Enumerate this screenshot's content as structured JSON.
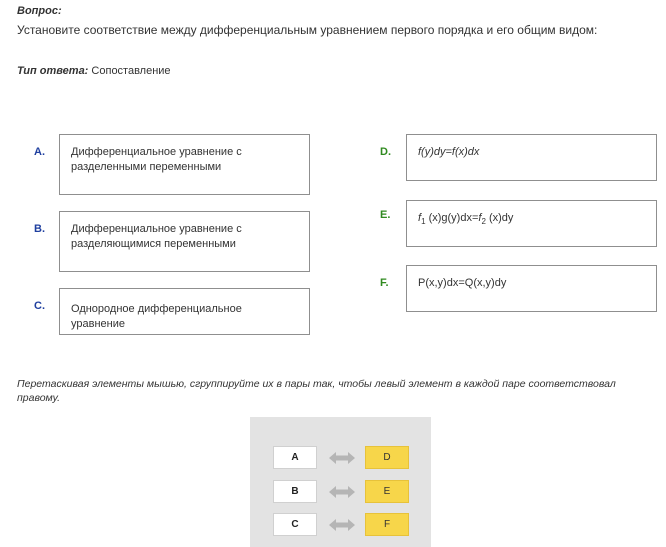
{
  "question": {
    "label": "Вопрос:",
    "text": "Установите соответствие между дифференциальным уравнением первого порядка и его общим видом:"
  },
  "answer_type": {
    "label": "Тип ответа:",
    "value": "Сопоставление"
  },
  "left_items": [
    {
      "letter": "A.",
      "text": "Дифференциальное уравнение с разделенными переменными"
    },
    {
      "letter": "B.",
      "text": "Дифференциальное уравнение с разделяющимися переменными"
    },
    {
      "letter": "C.",
      "text": "Однородное дифференциальное уравнение"
    }
  ],
  "right_items": [
    {
      "letter": "D.",
      "text": "f(y)dy=f(x)dx"
    },
    {
      "letter": "E.",
      "text": "f1 (x)g(y)dx=f2 (x)dy"
    },
    {
      "letter": "F.",
      "text": "P(x,y)dx=Q(x,y)dy"
    }
  ],
  "instruction": "Перетаскивая элементы мышью, сгруппируйте их в пары так, чтобы левый элемент в каждой паре соответствовал правому.",
  "pairs": [
    {
      "left": "A",
      "right": "D"
    },
    {
      "left": "B",
      "right": "E"
    },
    {
      "left": "C",
      "right": "F"
    }
  ],
  "colors": {
    "left_letter": "#1f3f9f",
    "right_letter": "#2f8a1f",
    "answer_chip": "#f7d64a",
    "panel": "#e3e3e3"
  }
}
